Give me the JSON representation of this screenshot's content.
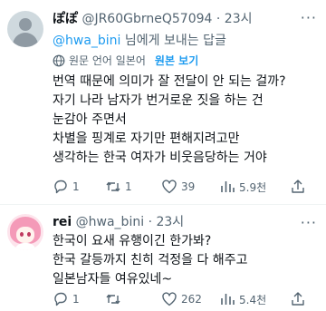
{
  "tweets": [
    {
      "name": "ぽぽ",
      "handle": "@JR60GbrneQ57094",
      "time": "23시",
      "reply_prefix": "@hwa_bini",
      "reply_suffix": " 님에게 보내는 답글",
      "translate": {
        "label": "원문 언어 일본어",
        "show_original": "원본 보기"
      },
      "text": "번역 때문에 의미가 잘 전달이 안 되는 걸까?\n자기 나라 남자가 번거로운 짓을 하는 건\n눈감아 주면서\n차별을 핑계로 자기만 편해지려고만\n생각하는 한국 여자가 비웃음당하는 거야",
      "stats": {
        "replies": "1",
        "retweets": "1",
        "likes": "39",
        "views": "5.9천"
      }
    },
    {
      "name": "rei",
      "handle": "@hwa_bini",
      "time": "23시",
      "text": "한국이 요새 유행이긴 한가봐?\n한국 갈등까지 친히 걱정을 다 해주고\n일본남자들 여유있네~",
      "stats": {
        "replies": "1",
        "retweets": "",
        "likes": "262",
        "views": "5.4천"
      }
    }
  ],
  "colors": {
    "accent": "#1d9bf0",
    "muted": "#536471",
    "text": "#0f1419"
  },
  "icons": [
    "more-icon",
    "globe-icon",
    "reply-icon",
    "retweet-icon",
    "like-icon",
    "views-icon",
    "share-icon"
  ]
}
